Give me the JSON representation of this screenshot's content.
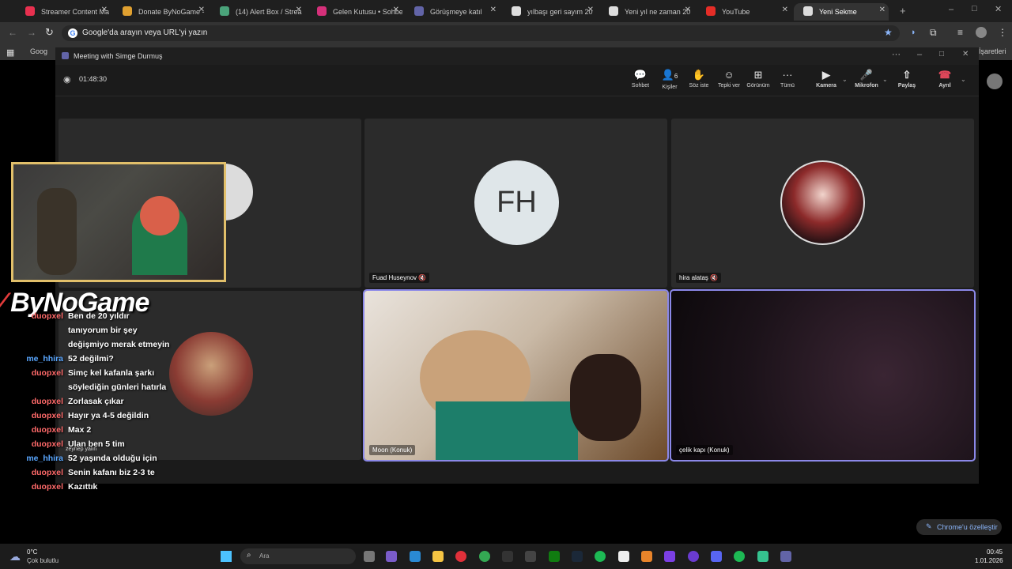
{
  "tabs": [
    {
      "label": "Streamer Content Ma",
      "color": "#e8304f"
    },
    {
      "label": "Donate ByNoGame -",
      "color": "#e0a030"
    },
    {
      "label": "(14) Alert Box / Strea",
      "color": "#4aa37a"
    },
    {
      "label": "Gelen Kutusu • Sohbe",
      "color": "#d5307a"
    },
    {
      "label": "Görüşmeye katıl",
      "color": "#6264a7"
    },
    {
      "label": "yılbaşı geri sayım 20",
      "color": "#dddddd"
    },
    {
      "label": "Yeni yıl ne zaman 20",
      "color": "#dddddd"
    },
    {
      "label": "YouTube",
      "color": "#e52d27"
    },
    {
      "label": "Yeni Sekme",
      "color": "#dddddd"
    }
  ],
  "omnibox": {
    "placeholder": "Google'da arayın veya URL'yi yazın"
  },
  "bookmarks": {
    "first": "Goog",
    "last": "İşaretleri"
  },
  "teams": {
    "window_title": "Meeting with Simge Durmuş",
    "timer": "01:48:30",
    "toolbar": {
      "chat": "Sohbet",
      "people": "Kişiler",
      "people_count": "6",
      "raise_hand": "Söz iste",
      "react": "Tepki ver",
      "view": "Görünüm",
      "more": "Tümü",
      "camera": "Kamera",
      "mic": "Mikrofon",
      "share": "Paylaş",
      "leave": "Ayrıl"
    },
    "participants": [
      {
        "name": "Fuad Huseynov",
        "initials": "FH"
      },
      {
        "name": "hira alataş"
      },
      {
        "name": "Moon (Konuk)"
      },
      {
        "name": "çelik kapı (Konuk)"
      },
      {
        "name": "zeynep yalın"
      }
    ]
  },
  "overlay": {
    "brand": "ByNoGame",
    "chat": [
      {
        "user": "duopxel",
        "msg": "Ben de 20 yıldır",
        "color": "#ff6a6a"
      },
      {
        "user": "",
        "msg": "tanıyorum bir şey",
        "color": "#ff6a6a"
      },
      {
        "user": "",
        "msg": "değişmiyo merak etmeyin",
        "color": "#ff6a6a"
      },
      {
        "user": "me_hhira",
        "msg": "52 değilmi?",
        "color": "#5aa7ff"
      },
      {
        "user": "duopxel",
        "msg": "Simç kel kafanla şarkı",
        "color": "#ff6a6a"
      },
      {
        "user": "",
        "msg": "söylediğin günleri hatırla",
        "color": "#ff6a6a"
      },
      {
        "user": "duopxel",
        "msg": "Zorlasak çıkar",
        "color": "#ff6a6a"
      },
      {
        "user": "duopxel",
        "msg": "Hayır ya 4-5 değildin",
        "color": "#ff6a6a"
      },
      {
        "user": "duopxel",
        "msg": "Max 2",
        "color": "#ff6a6a"
      },
      {
        "user": "duopxel",
        "msg": "Ulan ben 5 tim",
        "color": "#ff6a6a"
      },
      {
        "user": "me_hhira",
        "msg": "52 yaşında olduğu için",
        "color": "#5aa7ff"
      },
      {
        "user": "duopxel",
        "msg": "Senin kafanı biz 2-3 te",
        "color": "#ff6a6a"
      },
      {
        "user": "duopxel",
        "msg": "Kazıttık",
        "color": "#ff6a6a"
      }
    ]
  },
  "chrome_customize": "Chrome'u özelleştir",
  "taskbar": {
    "weather_temp": "0°C",
    "weather_desc": "Çok bulutlu",
    "search_placeholder": "Ara",
    "time": "00:45",
    "date": "1.01.2026"
  }
}
